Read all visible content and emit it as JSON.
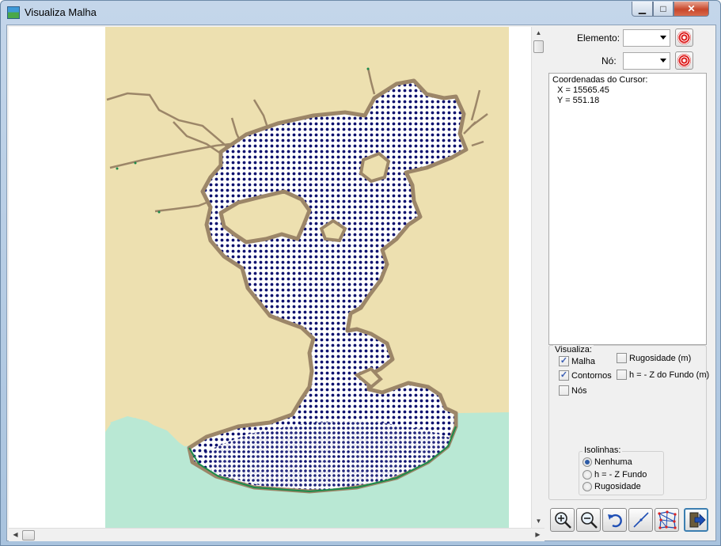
{
  "window": {
    "title": "Visualiza Malha",
    "controls": {
      "minimize": "▁",
      "maximize": "□",
      "close": "✕"
    }
  },
  "panel": {
    "elemento_label": "Elemento:",
    "no_label": "Nó:",
    "elemento_value": "",
    "no_value": ""
  },
  "coords": {
    "heading": "Coordenadas do Cursor:",
    "x_line": "  X = 15565.45",
    "y_line": "  Y = 551.18"
  },
  "visualiza": {
    "legend": "Visualiza:",
    "malha": {
      "label": "Malha",
      "checked": true
    },
    "contornos": {
      "label": "Contornos",
      "checked": true
    },
    "nos": {
      "label": "Nós",
      "checked": false
    },
    "rugosidade": {
      "label": "Rugosidade (m)",
      "checked": false
    },
    "hfundo": {
      "label": "h = - Z do Fundo (m)",
      "checked": false
    }
  },
  "isolinhas": {
    "legend": "Isolinhas:",
    "options": [
      {
        "label": "Nenhuma",
        "selected": true
      },
      {
        "label": "h = - Z Fundo",
        "selected": false
      },
      {
        "label": "Rugosidade",
        "selected": false
      }
    ]
  },
  "toolbar": {
    "icons": [
      "zoom-in-icon",
      "zoom-out-icon",
      "undo-icon",
      "line-icon",
      "mesh-icon",
      "exit-icon"
    ]
  },
  "colors": {
    "land": "#ede0b0",
    "sea": "#b9e8d4",
    "mesh": "#0a0f6e",
    "coast": "#9c8668",
    "boundary": "#1a8a4a"
  }
}
